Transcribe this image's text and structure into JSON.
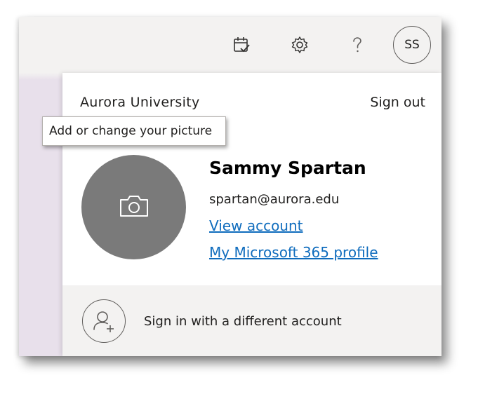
{
  "header": {
    "icons": [
      "calendar-check-icon",
      "gear-icon",
      "help-icon"
    ],
    "avatar_initials": "SS"
  },
  "account_panel": {
    "organization": "Aurora University",
    "sign_out_label": "Sign out",
    "user_name": "Sammy Spartan",
    "email": "spartan@aurora.edu",
    "view_account_label": "View account",
    "profile_label": "My Microsoft 365 profile",
    "other_account_label": "Sign in with a different account",
    "avatar_icon": "camera-icon",
    "other_account_icon": "add-person-icon"
  },
  "tooltip": {
    "text": "Add or change your picture"
  },
  "colors": {
    "link": "#0f6cbd",
    "avatar_fill": "#7a7a7a",
    "topbar_bg": "#f3f2f1",
    "sidebar_tint": "#e8e0eb"
  }
}
